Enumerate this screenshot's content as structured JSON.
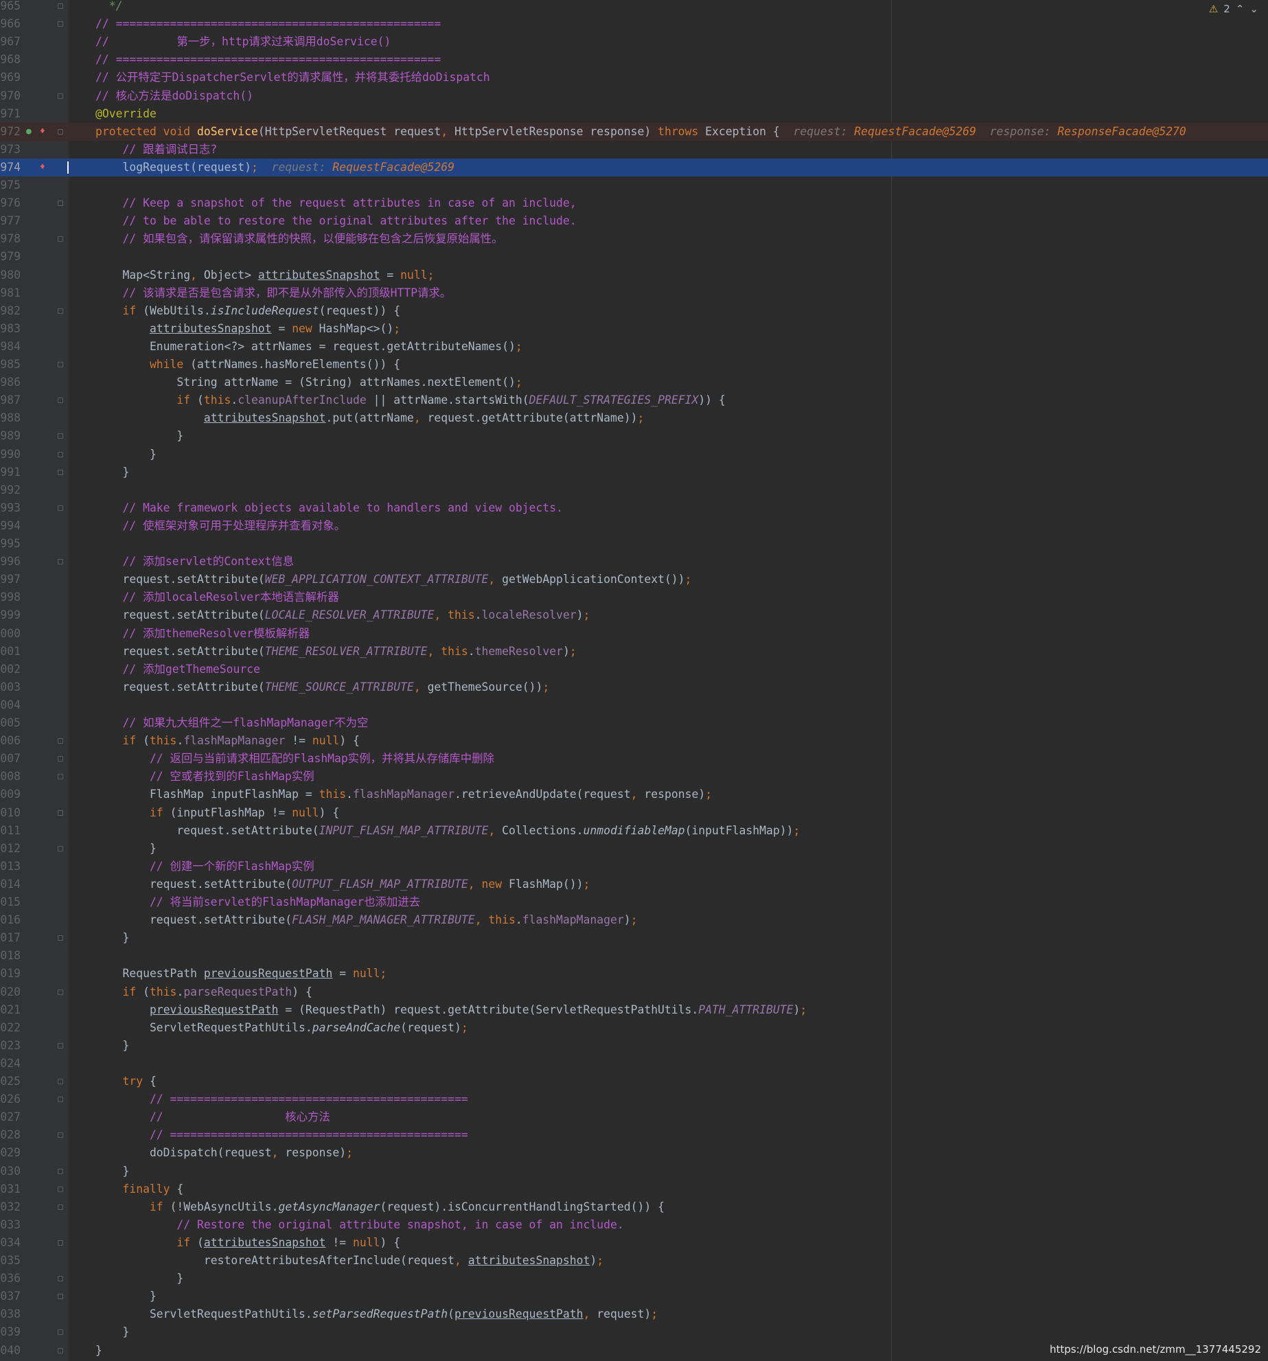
{
  "editor": {
    "warning_count": "2",
    "icons": {
      "warning": "warning-triangle-icon",
      "prev": "chevron-up-icon",
      "next": "chevron-down-icon",
      "breakpoint": "breakpoint-icon",
      "override": "override-method-icon",
      "fold": "fold-marker-icon"
    }
  },
  "colors": {
    "background": "#2b2b2b",
    "gutter": "#313335",
    "current_line": "#214283",
    "keyword": "#cc7832",
    "comment": "#b259c8",
    "method": "#ffc66d",
    "field": "#9876aa",
    "annotation": "#bbb529",
    "debug_value": "#cc7832",
    "breakpoint": "#db5c5c"
  },
  "lines": [
    {
      "n": "965",
      "fold": true,
      "p": [
        [
          "cg",
          "  */"
        ]
      ]
    },
    {
      "n": "966",
      "fold": true,
      "p": [
        [
          "c",
          "// ================================================"
        ]
      ]
    },
    {
      "n": "967",
      "p": [
        [
          "c",
          "//          第一步，http请求过来调用doService()"
        ]
      ]
    },
    {
      "n": "968",
      "p": [
        [
          "c",
          "// ================================================"
        ]
      ]
    },
    {
      "n": "969",
      "p": [
        [
          "c",
          "// 公开特定于DispatcherServlet的请求属性，并将其委托给doDispatch"
        ]
      ]
    },
    {
      "n": "970",
      "fold": true,
      "p": [
        [
          "c",
          "// 核心方法是doDispatch()"
        ]
      ]
    },
    {
      "n": "971",
      "p": [
        [
          "an",
          "@Override"
        ]
      ]
    },
    {
      "n": "972",
      "fold": true,
      "bp": true,
      "ov": true,
      "bg": "bp",
      "p": [
        [
          "k",
          "protected void "
        ],
        [
          "m",
          "doService"
        ],
        [
          "",
          "(HttpServletRequest request"
        ],
        [
          "k",
          ", "
        ],
        [
          "",
          "HttpServletResponse response) "
        ],
        [
          "k",
          "throws "
        ],
        [
          "",
          "Exception {  "
        ],
        [
          "d",
          "request: "
        ],
        [
          "dv",
          "RequestFacade@5269"
        ],
        [
          "d",
          "  response: "
        ],
        [
          "dv",
          "ResponseFacade@5270"
        ]
      ]
    },
    {
      "n": "973",
      "p": [
        [
          "c",
          "    // 跟着调试日志?"
        ]
      ]
    },
    {
      "n": "974",
      "bp": true,
      "cur": true,
      "p": [
        [
          "",
          "    logRequest(request)"
        ],
        [
          "k",
          ";"
        ],
        [
          "d",
          "  request: "
        ],
        [
          "dv",
          "RequestFacade@5269"
        ]
      ]
    },
    {
      "n": "975",
      "p": []
    },
    {
      "n": "976",
      "fold": true,
      "p": [
        [
          "c",
          "    // Keep a snapshot of the request attributes in case of an include,"
        ]
      ]
    },
    {
      "n": "977",
      "p": [
        [
          "c",
          "    // to be able to restore the original attributes after the include."
        ]
      ]
    },
    {
      "n": "978",
      "fold": true,
      "p": [
        [
          "c",
          "    // 如果包含，请保留请求属性的快照，以便能够在包含之后恢复原始属性。"
        ]
      ]
    },
    {
      "n": "979",
      "p": []
    },
    {
      "n": "980",
      "p": [
        [
          "",
          "    Map<String"
        ],
        [
          "k",
          ", "
        ],
        [
          "",
          "Object> "
        ],
        [
          "u",
          "attributesSnapshot"
        ],
        [
          "",
          " = "
        ],
        [
          "k",
          "null;"
        ]
      ]
    },
    {
      "n": "981",
      "p": [
        [
          "c",
          "    // 该请求是否是包含请求，即不是从外部传入的顶级HTTP请求。"
        ]
      ]
    },
    {
      "n": "982",
      "fold": true,
      "p": [
        [
          "k",
          "    if "
        ],
        [
          "",
          "(WebUtils."
        ],
        [
          "it",
          "isIncludeRequest"
        ],
        [
          "",
          "(request)) {"
        ]
      ]
    },
    {
      "n": "983",
      "p": [
        [
          "",
          "        "
        ],
        [
          "u",
          "attributesSnapshot"
        ],
        [
          "",
          " = "
        ],
        [
          "k",
          "new "
        ],
        [
          "",
          "HashMap<>()"
        ],
        [
          "k",
          ";"
        ]
      ]
    },
    {
      "n": "984",
      "p": [
        [
          "",
          "        Enumeration<?> attrNames = request.getAttributeNames()"
        ],
        [
          "k",
          ";"
        ]
      ]
    },
    {
      "n": "985",
      "fold": true,
      "p": [
        [
          "k",
          "        while "
        ],
        [
          "",
          "(attrNames.hasMoreElements()) {"
        ]
      ]
    },
    {
      "n": "986",
      "p": [
        [
          "",
          "            String attrName = (String) attrNames.nextElement()"
        ],
        [
          "k",
          ";"
        ]
      ]
    },
    {
      "n": "987",
      "fold": true,
      "p": [
        [
          "k",
          "            if "
        ],
        [
          "",
          "("
        ],
        [
          "k",
          "this"
        ],
        [
          "",
          "."
        ],
        [
          "f",
          "cleanupAfterInclude"
        ],
        [
          "",
          " || attrName.startsWith("
        ],
        [
          "s",
          "DEFAULT_STRATEGIES_PREFIX"
        ],
        [
          "",
          ")) {"
        ]
      ]
    },
    {
      "n": "988",
      "p": [
        [
          "",
          "                "
        ],
        [
          "u",
          "attributesSnapshot"
        ],
        [
          "",
          ".put(attrName"
        ],
        [
          "k",
          ", "
        ],
        [
          "",
          "request.getAttribute(attrName))"
        ],
        [
          "k",
          ";"
        ]
      ]
    },
    {
      "n": "989",
      "fold": true,
      "p": [
        [
          "",
          "            }"
        ]
      ]
    },
    {
      "n": "990",
      "fold": true,
      "p": [
        [
          "",
          "        }"
        ]
      ]
    },
    {
      "n": "991",
      "fold": true,
      "p": [
        [
          "",
          "    }"
        ]
      ]
    },
    {
      "n": "992",
      "p": []
    },
    {
      "n": "993",
      "fold": true,
      "p": [
        [
          "c",
          "    // Make framework objects available to handlers and view objects."
        ]
      ]
    },
    {
      "n": "994",
      "p": [
        [
          "c",
          "    // 使框架对象可用于处理程序并查看对象。"
        ]
      ]
    },
    {
      "n": "995",
      "p": []
    },
    {
      "n": "996",
      "fold": true,
      "p": [
        [
          "c",
          "    // 添加servlet的Context信息"
        ]
      ]
    },
    {
      "n": "997",
      "p": [
        [
          "",
          "    request.setAttribute("
        ],
        [
          "s",
          "WEB_APPLICATION_CONTEXT_ATTRIBUTE"
        ],
        [
          "k",
          ", "
        ],
        [
          "",
          "getWebApplicationContext())"
        ],
        [
          "k",
          ";"
        ]
      ]
    },
    {
      "n": "998",
      "p": [
        [
          "c",
          "    // 添加localeResolver本地语言解析器"
        ]
      ]
    },
    {
      "n": "999",
      "p": [
        [
          "",
          "    request.setAttribute("
        ],
        [
          "s",
          "LOCALE_RESOLVER_ATTRIBUTE"
        ],
        [
          "k",
          ", this"
        ],
        [
          "",
          "."
        ],
        [
          "f",
          "localeResolver"
        ],
        [
          "",
          ")"
        ],
        [
          "k",
          ";"
        ]
      ]
    },
    {
      "n": "1000",
      "p": [
        [
          "c",
          "    // 添加themeResolver模板解析器"
        ]
      ]
    },
    {
      "n": "1001",
      "p": [
        [
          "",
          "    request.setAttribute("
        ],
        [
          "s",
          "THEME_RESOLVER_ATTRIBUTE"
        ],
        [
          "k",
          ", this"
        ],
        [
          "",
          "."
        ],
        [
          "f",
          "themeResolver"
        ],
        [
          "",
          ")"
        ],
        [
          "k",
          ";"
        ]
      ]
    },
    {
      "n": "1002",
      "p": [
        [
          "c",
          "    // 添加getThemeSource"
        ]
      ]
    },
    {
      "n": "1003",
      "p": [
        [
          "",
          "    request.setAttribute("
        ],
        [
          "s",
          "THEME_SOURCE_ATTRIBUTE"
        ],
        [
          "k",
          ", "
        ],
        [
          "",
          "getThemeSource())"
        ],
        [
          "k",
          ";"
        ]
      ]
    },
    {
      "n": "1004",
      "p": []
    },
    {
      "n": "1005",
      "p": [
        [
          "c",
          "    // 如果九大组件之一flashMapManager不为空"
        ]
      ]
    },
    {
      "n": "1006",
      "fold": true,
      "p": [
        [
          "k",
          "    if "
        ],
        [
          "",
          "("
        ],
        [
          "k",
          "this"
        ],
        [
          "",
          "."
        ],
        [
          "f",
          "flashMapManager"
        ],
        [
          "",
          " != "
        ],
        [
          "k",
          "null"
        ],
        [
          "",
          ") {"
        ]
      ]
    },
    {
      "n": "1007",
      "fold": true,
      "p": [
        [
          "c",
          "        // 返回与当前请求相匹配的FlashMap实例，并将其从存储库中删除"
        ]
      ]
    },
    {
      "n": "1008",
      "fold": true,
      "p": [
        [
          "c",
          "        // 空或者找到的FlashMap实例"
        ]
      ]
    },
    {
      "n": "1009",
      "p": [
        [
          "",
          "        FlashMap inputFlashMap = "
        ],
        [
          "k",
          "this"
        ],
        [
          "",
          "."
        ],
        [
          "f",
          "flashMapManager"
        ],
        [
          "",
          ".retrieveAndUpdate(request"
        ],
        [
          "k",
          ", "
        ],
        [
          "",
          "response)"
        ],
        [
          "k",
          ";"
        ]
      ]
    },
    {
      "n": "1010",
      "fold": true,
      "p": [
        [
          "k",
          "        if "
        ],
        [
          "",
          "(inputFlashMap != "
        ],
        [
          "k",
          "null"
        ],
        [
          "",
          ") {"
        ]
      ]
    },
    {
      "n": "1011",
      "p": [
        [
          "",
          "            request.setAttribute("
        ],
        [
          "s",
          "INPUT_FLASH_MAP_ATTRIBUTE"
        ],
        [
          "k",
          ", "
        ],
        [
          "",
          "Collections."
        ],
        [
          "it",
          "unmodifiableMap"
        ],
        [
          "",
          "(inputFlashMap))"
        ],
        [
          "k",
          ";"
        ]
      ]
    },
    {
      "n": "1012",
      "fold": true,
      "p": [
        [
          "",
          "        }"
        ]
      ]
    },
    {
      "n": "1013",
      "p": [
        [
          "c",
          "        // 创建一个新的FlashMap实例"
        ]
      ]
    },
    {
      "n": "1014",
      "p": [
        [
          "",
          "        request.setAttribute("
        ],
        [
          "s",
          "OUTPUT_FLASH_MAP_ATTRIBUTE"
        ],
        [
          "k",
          ", new "
        ],
        [
          "",
          "FlashMap())"
        ],
        [
          "k",
          ";"
        ]
      ]
    },
    {
      "n": "1015",
      "p": [
        [
          "c",
          "        // 将当前servlet的FlashMapManager也添加进去"
        ]
      ]
    },
    {
      "n": "1016",
      "p": [
        [
          "",
          "        request.setAttribute("
        ],
        [
          "s",
          "FLASH_MAP_MANAGER_ATTRIBUTE"
        ],
        [
          "k",
          ", this"
        ],
        [
          "",
          "."
        ],
        [
          "f",
          "flashMapManager"
        ],
        [
          "",
          ")"
        ],
        [
          "k",
          ";"
        ]
      ]
    },
    {
      "n": "1017",
      "fold": true,
      "p": [
        [
          "",
          "    }"
        ]
      ]
    },
    {
      "n": "1018",
      "p": []
    },
    {
      "n": "1019",
      "p": [
        [
          "",
          "    RequestPath "
        ],
        [
          "u",
          "previousRequestPath"
        ],
        [
          "",
          " = "
        ],
        [
          "k",
          "null;"
        ]
      ]
    },
    {
      "n": "1020",
      "fold": true,
      "p": [
        [
          "k",
          "    if "
        ],
        [
          "",
          "("
        ],
        [
          "k",
          "this"
        ],
        [
          "",
          "."
        ],
        [
          "f",
          "parseRequestPath"
        ],
        [
          "",
          ") {"
        ]
      ]
    },
    {
      "n": "1021",
      "p": [
        [
          "",
          "        "
        ],
        [
          "u",
          "previousRequestPath"
        ],
        [
          "",
          " = (RequestPath) request.getAttribute(ServletRequestPathUtils."
        ],
        [
          "s",
          "PATH_ATTRIBUTE"
        ],
        [
          "",
          ")"
        ],
        [
          "k",
          ";"
        ]
      ]
    },
    {
      "n": "1022",
      "p": [
        [
          "",
          "        ServletRequestPathUtils."
        ],
        [
          "it",
          "parseAndCache"
        ],
        [
          "",
          "(request)"
        ],
        [
          "k",
          ";"
        ]
      ]
    },
    {
      "n": "1023",
      "fold": true,
      "p": [
        [
          "",
          "    }"
        ]
      ]
    },
    {
      "n": "1024",
      "p": []
    },
    {
      "n": "1025",
      "fold": true,
      "p": [
        [
          "k",
          "    try "
        ],
        [
          "",
          "{"
        ]
      ]
    },
    {
      "n": "1026",
      "fold": true,
      "p": [
        [
          "c",
          "        // ============================================"
        ]
      ]
    },
    {
      "n": "1027",
      "p": [
        [
          "c",
          "        //                  核心方法"
        ]
      ]
    },
    {
      "n": "1028",
      "fold": true,
      "p": [
        [
          "c",
          "        // ============================================"
        ]
      ]
    },
    {
      "n": "1029",
      "p": [
        [
          "",
          "        doDispatch(request"
        ],
        [
          "k",
          ", "
        ],
        [
          "",
          "response)"
        ],
        [
          "k",
          ";"
        ]
      ]
    },
    {
      "n": "1030",
      "fold": true,
      "p": [
        [
          "",
          "    }"
        ]
      ]
    },
    {
      "n": "1031",
      "fold": true,
      "p": [
        [
          "k",
          "    finally "
        ],
        [
          "",
          "{"
        ]
      ]
    },
    {
      "n": "1032",
      "fold": true,
      "p": [
        [
          "k",
          "        if "
        ],
        [
          "",
          "(!WebAsyncUtils."
        ],
        [
          "it",
          "getAsyncManager"
        ],
        [
          "",
          "(request).isConcurrentHandlingStarted()) {"
        ]
      ]
    },
    {
      "n": "1033",
      "p": [
        [
          "c",
          "            // Restore the original attribute snapshot, in case of an include."
        ]
      ]
    },
    {
      "n": "1034",
      "fold": true,
      "p": [
        [
          "k",
          "            if "
        ],
        [
          "",
          "("
        ],
        [
          "u",
          "attributesSnapshot"
        ],
        [
          "",
          " != "
        ],
        [
          "k",
          "null"
        ],
        [
          "",
          ") {"
        ]
      ]
    },
    {
      "n": "1035",
      "p": [
        [
          "",
          "                restoreAttributesAfterInclude(request"
        ],
        [
          "k",
          ", "
        ],
        [
          "u",
          "attributesSnapshot"
        ],
        [
          "",
          ")"
        ],
        [
          "k",
          ";"
        ]
      ]
    },
    {
      "n": "1036",
      "fold": true,
      "p": [
        [
          "",
          "            }"
        ]
      ]
    },
    {
      "n": "1037",
      "fold": true,
      "p": [
        [
          "",
          "        }"
        ]
      ]
    },
    {
      "n": "1038",
      "p": [
        [
          "",
          "        ServletRequestPathUtils."
        ],
        [
          "it",
          "setParsedRequestPath"
        ],
        [
          "",
          "("
        ],
        [
          "u",
          "previousRequestPath"
        ],
        [
          "k",
          ", "
        ],
        [
          "",
          "request)"
        ],
        [
          "k",
          ";"
        ]
      ]
    },
    {
      "n": "1039",
      "fold": true,
      "p": [
        [
          "",
          "    }"
        ]
      ]
    },
    {
      "n": "1040",
      "fold": true,
      "p": [
        [
          "",
          "}"
        ]
      ]
    }
  ],
  "watermark": "https://blog.csdn.net/zmm__1377445292"
}
